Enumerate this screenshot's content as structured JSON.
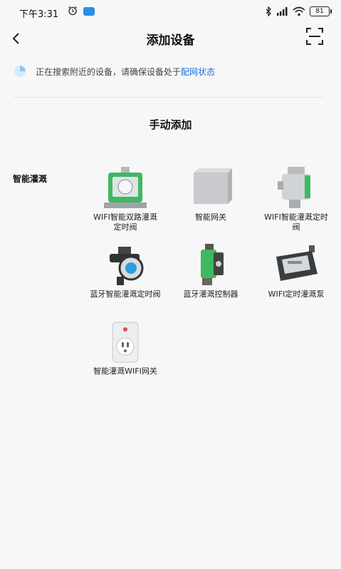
{
  "status_bar": {
    "time": "下午3:31",
    "battery": "81"
  },
  "header": {
    "title": "添加设备"
  },
  "search_hint": {
    "text": "正在搜索附近的设备，请确保设备处于",
    "link": "配网状态"
  },
  "section": {
    "title": "手动添加"
  },
  "category": {
    "label": "智能灌溉"
  },
  "devices": [
    {
      "name": "WIFI智能双路灌溉定时阀",
      "icon": "dual-valve-timer"
    },
    {
      "name": "智能网关",
      "icon": "gateway-box"
    },
    {
      "name": "WIFI智能灌溉定时阀",
      "icon": "valve-timer"
    },
    {
      "name": "蓝牙智能灌溉定时阀",
      "icon": "bluetooth-valve"
    },
    {
      "name": "蓝牙灌溉控制器",
      "icon": "bluetooth-controller"
    },
    {
      "name": "WIFI定时灌溉泵",
      "icon": "timer-pump"
    },
    {
      "name": "智能灌溉WIFI网关",
      "icon": "wifi-plug-gateway"
    }
  ],
  "colors": {
    "accent": "#1f6fe0",
    "device_green": "#3fb860"
  }
}
